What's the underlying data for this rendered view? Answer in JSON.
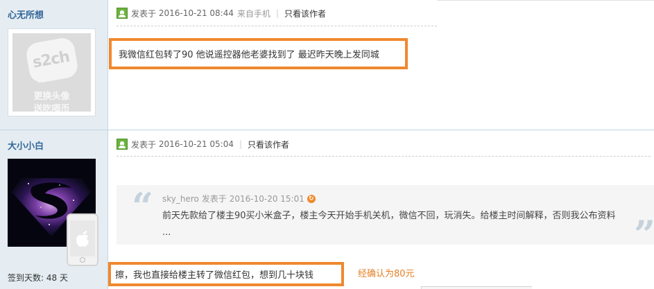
{
  "posts": [
    {
      "username": "心无所想",
      "avatar": {
        "logo_text": "s2ch",
        "line1": "更换头像",
        "line2": "送吃喝币"
      },
      "meta": {
        "posted_label": "发表于",
        "date": "2016-10-21 08:44",
        "from": "来自手机",
        "author_only": "只看该作者"
      },
      "content": "我微信红包转了90 他说遥控器他老婆找到了 最迟昨天晚上发同城"
    },
    {
      "username": "大小小白",
      "meta": {
        "posted_label": "发表于",
        "date": "2016-10-21 05:04",
        "author_only": "只看该作者"
      },
      "quote": {
        "author": "sky_hero",
        "posted_label": "发表于",
        "date": "2016-10-20 15:01",
        "text": "前天先款给了楼主90买小米盒子，楼主今天开始手机关机，微信不回，玩消失。给楼主时间解释，否则我公布资料 ..."
      },
      "content": "擦，我也直接给楼主转了微信红包，想到几十块钱",
      "annotation": "经确认为80元",
      "sign_days": "签到天数: 48 天"
    }
  ],
  "icons": {
    "online": "online-status-icon",
    "quote_open": "quote-open-icon",
    "quote_close": "quote-close-icon",
    "back": "jump-to-post-icon",
    "phone": "mobile-phone-icon"
  },
  "colors": {
    "highlight_border": "#f0882f",
    "annotation": "#e57f23",
    "username": "#336699",
    "sidebar_bg": "#e5edf2"
  }
}
